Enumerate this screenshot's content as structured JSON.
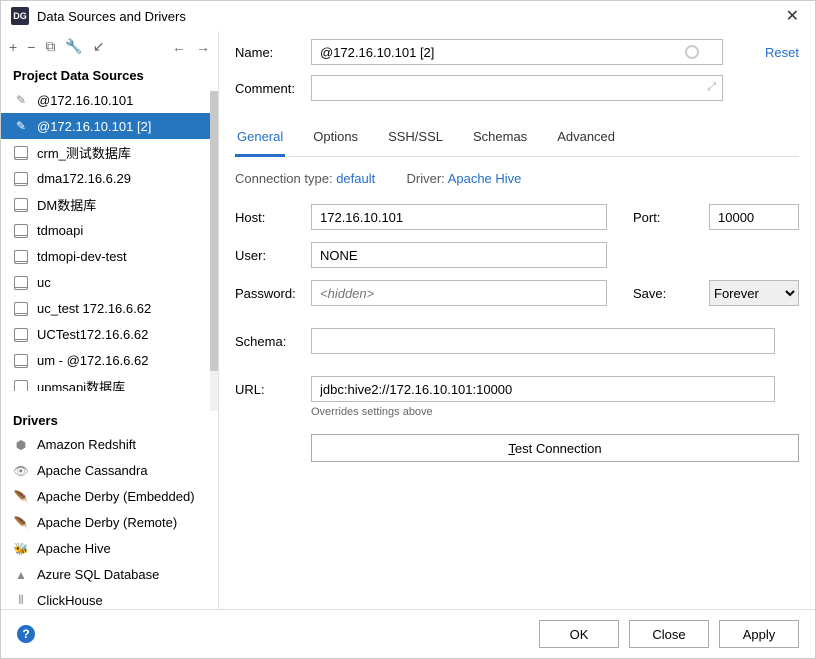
{
  "window": {
    "app_badge": "DG",
    "title": "Data Sources and Drivers"
  },
  "sidebar": {
    "sections": {
      "datasources": {
        "header": "Project Data Sources",
        "items": [
          {
            "label": "@172.16.10.101",
            "selected": false,
            "icon": "pencil"
          },
          {
            "label": "@172.16.10.101 [2]",
            "selected": true,
            "icon": "pencil"
          },
          {
            "label": "crm_测试数据库",
            "selected": false,
            "icon": "db"
          },
          {
            "label": "dma172.16.6.29",
            "selected": false,
            "icon": "db"
          },
          {
            "label": "DM数据库",
            "selected": false,
            "icon": "db"
          },
          {
            "label": "tdmoapi",
            "selected": false,
            "icon": "db"
          },
          {
            "label": "tdmopi-dev-test",
            "selected": false,
            "icon": "db"
          },
          {
            "label": "uc",
            "selected": false,
            "icon": "db"
          },
          {
            "label": "uc_test 172.16.6.62",
            "selected": false,
            "icon": "db"
          },
          {
            "label": "UCTest172.16.6.62",
            "selected": false,
            "icon": "db"
          },
          {
            "label": "um - @172.16.6.62",
            "selected": false,
            "icon": "db"
          },
          {
            "label": "upmsapi数据库",
            "selected": false,
            "icon": "db"
          }
        ]
      },
      "drivers": {
        "header": "Drivers",
        "items": [
          {
            "label": "Amazon Redshift"
          },
          {
            "label": "Apache Cassandra"
          },
          {
            "label": "Apache Derby (Embedded)"
          },
          {
            "label": "Apache Derby (Remote)"
          },
          {
            "label": "Apache Hive"
          },
          {
            "label": "Azure SQL Database"
          },
          {
            "label": "ClickHouse"
          }
        ]
      }
    }
  },
  "form": {
    "name_label": "Name:",
    "name_value": "@172.16.10.101 [2]",
    "reset": "Reset",
    "comment_label": "Comment:",
    "tabs": [
      "General",
      "Options",
      "SSH/SSL",
      "Schemas",
      "Advanced"
    ],
    "active_tab": 0,
    "conn_type_label": "Connection type:",
    "conn_type_value": "default",
    "driver_label": "Driver:",
    "driver_value": "Apache Hive",
    "host_label": "Host:",
    "host_value": "172.16.10.101",
    "port_label": "Port:",
    "port_value": "10000",
    "user_label": "User:",
    "user_value": "NONE",
    "password_label": "Password:",
    "password_placeholder": "<hidden>",
    "save_label": "Save:",
    "save_value": "Forever",
    "schema_label": "Schema:",
    "schema_value": "",
    "url_label": "URL:",
    "url_value": "jdbc:hive2://172.16.10.101:10000",
    "url_note": "Overrides settings above",
    "test_button": "Test Connection"
  },
  "footer": {
    "ok": "OK",
    "close": "Close",
    "apply": "Apply"
  }
}
